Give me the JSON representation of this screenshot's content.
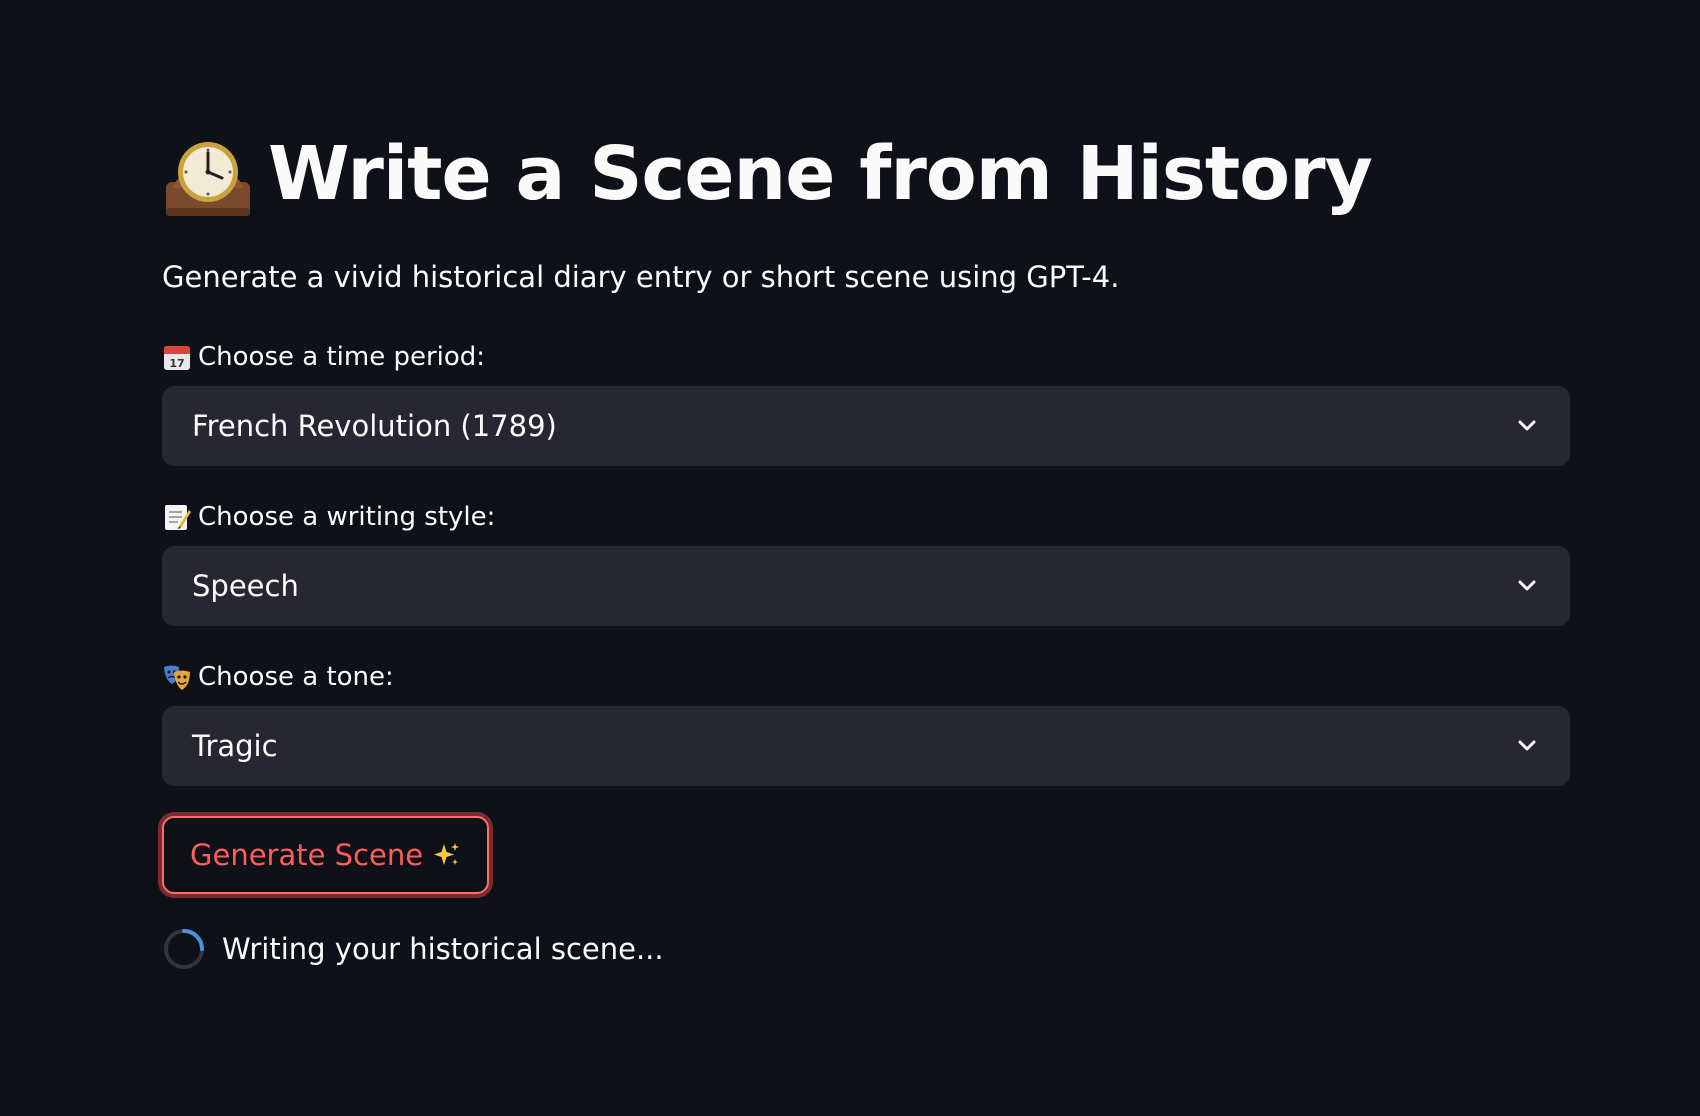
{
  "header": {
    "title": "Write a Scene from History",
    "title_icon": "mantelpiece-clock-icon",
    "subtitle": "Generate a vivid historical diary entry or short scene using GPT-4."
  },
  "form": {
    "time_period": {
      "label": "Choose a time period:",
      "icon": "calendar-icon",
      "selected": "French Revolution (1789)"
    },
    "writing_style": {
      "label": "Choose a writing style:",
      "icon": "memo-icon",
      "selected": "Speech"
    },
    "tone": {
      "label": "Choose a tone:",
      "icon": "theater-masks-icon",
      "selected": "Tragic"
    },
    "generate_button": {
      "label": "Generate Scene",
      "icon": "sparkles-icon"
    }
  },
  "status": {
    "text": "Writing your historical scene...",
    "icon": "spinner-icon"
  },
  "colors": {
    "background": "#0e1117",
    "select_background": "#262730",
    "text": "#fafafa",
    "accent": "#ff4b4b",
    "spinner": "#4a90e2"
  }
}
